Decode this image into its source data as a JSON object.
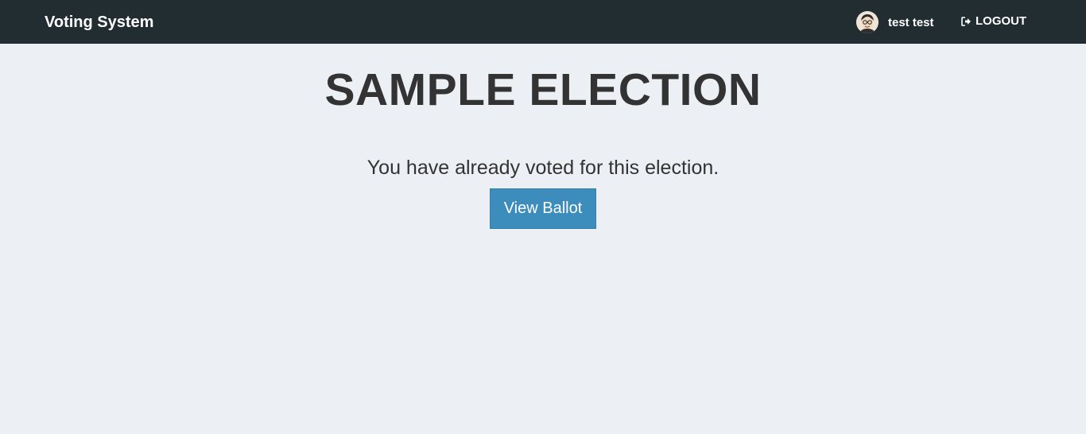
{
  "navbar": {
    "brand": "Voting System",
    "user_name": "test test",
    "logout_label": "LOGOUT",
    "background_color": "#222d32"
  },
  "main": {
    "title": "SAMPLE ELECTION",
    "message": "You have already voted for this election.",
    "view_ballot_label": "View Ballot",
    "button_color": "#3c8dbc",
    "background_color": "#ecf0f5"
  },
  "icons": {
    "avatar": "user-avatar",
    "logout": "sign-out-icon"
  }
}
